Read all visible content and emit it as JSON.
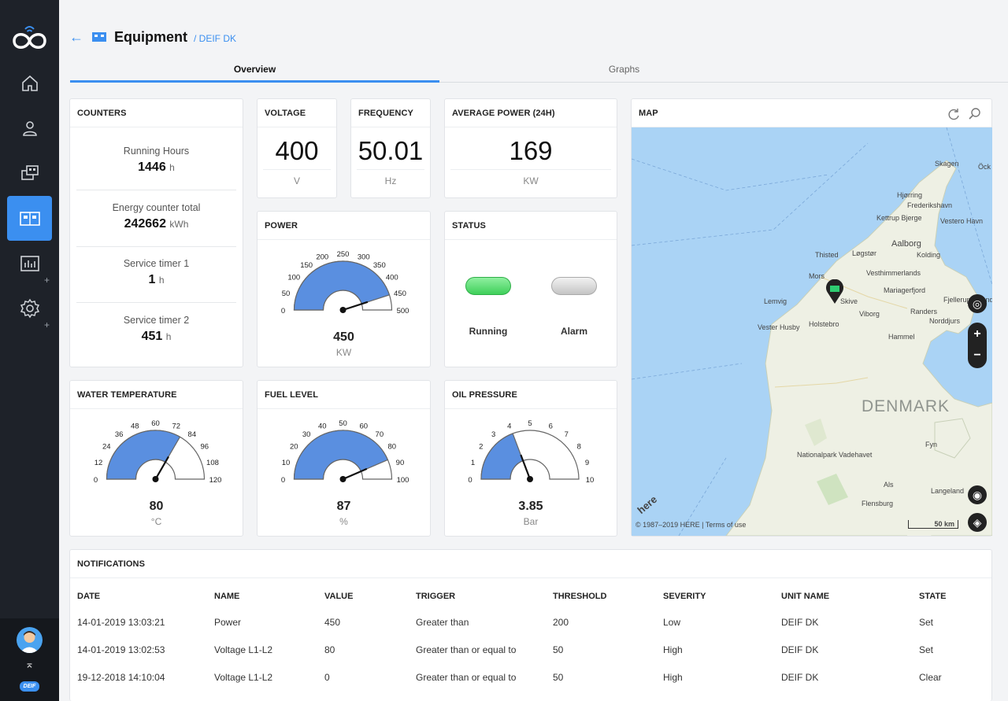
{
  "header": {
    "title": "Equipment",
    "breadcrumb": "/ DEIF DK"
  },
  "tabs": [
    {
      "label": "Overview",
      "active": true
    },
    {
      "label": "Graphs",
      "active": false
    }
  ],
  "counters": {
    "title": "COUNTERS",
    "items": [
      {
        "label": "Running Hours",
        "value": "1446",
        "unit": "h"
      },
      {
        "label": "Energy counter total",
        "value": "242662",
        "unit": "kWh"
      },
      {
        "label": "Service timer 1",
        "value": "1",
        "unit": "h"
      },
      {
        "label": "Service timer 2",
        "value": "451",
        "unit": "h"
      }
    ]
  },
  "voltage": {
    "title": "VOLTAGE",
    "value": "400",
    "unit": "V"
  },
  "frequency": {
    "title": "FREQUENCY",
    "value": "50.01",
    "unit": "Hz"
  },
  "avg_power": {
    "title": "AVERAGE POWER (24H)",
    "value": "169",
    "unit": "KW"
  },
  "power": {
    "title": "POWER",
    "value": "450",
    "unit": "KW",
    "min": 0,
    "max": 500,
    "fill_value": 450,
    "ticks": [
      "0",
      "50",
      "100",
      "150",
      "200",
      "250",
      "300",
      "350",
      "400",
      "450",
      "500"
    ]
  },
  "status": {
    "title": "STATUS",
    "running_label": "Running",
    "alarm_label": "Alarm",
    "running_color": "#4cd964",
    "alarm_color": "#cccccc"
  },
  "water_temp": {
    "title": "WATER TEMPERATURE",
    "value": "80",
    "unit": "°C",
    "min": 0,
    "max": 120,
    "fill_value": 80,
    "ticks": [
      "0",
      "12",
      "24",
      "36",
      "48",
      "60",
      "72",
      "84",
      "96",
      "108",
      "120"
    ]
  },
  "fuel_level": {
    "title": "FUEL LEVEL",
    "value": "87",
    "unit": "%",
    "min": 0,
    "max": 100,
    "fill_value": 87,
    "ticks": [
      "0",
      "10",
      "20",
      "30",
      "40",
      "50",
      "60",
      "70",
      "80",
      "90",
      "100"
    ]
  },
  "oil_pressure": {
    "title": "OIL PRESSURE",
    "value": "3.85",
    "unit": "Bar",
    "min": 0,
    "max": 10,
    "fill_value": 3.85,
    "ticks": [
      "0",
      "1",
      "2",
      "3",
      "4",
      "5",
      "6",
      "7",
      "8",
      "9",
      "10"
    ]
  },
  "map": {
    "title": "MAP",
    "country": "DENMARK",
    "attribution": "© 1987–2019 HERE | Terms of use",
    "scale": "50 km",
    "brand": "here",
    "places": [
      "Skagen",
      "Hjørring",
      "Frederikshavn",
      "Kettrup Bjerge",
      "Vestero Havn",
      "Aalborg",
      "Thisted",
      "Løgstør",
      "Kolding",
      "Mors",
      "Vesthimmerlands",
      "Mariagerfjord",
      "Lemvig",
      "Skive",
      "Viborg",
      "Randers",
      "Fjellerup Strand",
      "Norddjurs",
      "Vester Husby",
      "Holstebro",
      "Hammel",
      "Nationalpark Vadehavet",
      "Fyn",
      "Als",
      "Langeland",
      "Flensburg",
      "Öck"
    ],
    "zoom_in": "+",
    "zoom_out": "−"
  },
  "notifications": {
    "title": "NOTIFICATIONS",
    "columns": [
      "DATE",
      "NAME",
      "VALUE",
      "TRIGGER",
      "THRESHOLD",
      "SEVERITY",
      "UNIT NAME",
      "STATE"
    ],
    "rows": [
      [
        "14-01-2019 13:03:21",
        "Power",
        "450",
        "Greater than",
        "200",
        "Low",
        "DEIF DK",
        "Set"
      ],
      [
        "14-01-2019 13:02:53",
        "Voltage L1-L2",
        "80",
        "Greater than or equal to",
        "50",
        "High",
        "DEIF DK",
        "Set"
      ],
      [
        "19-12-2018 14:10:04",
        "Voltage L1-L2",
        "0",
        "Greater than or equal to",
        "50",
        "High",
        "DEIF DK",
        "Clear"
      ]
    ]
  },
  "colors": {
    "accent": "#3b8ff0",
    "gauge_fill": "#5a8fe0",
    "sidebar": "#1e2229"
  },
  "sidebar": {
    "items": [
      {
        "icon": "home-icon"
      },
      {
        "icon": "user-location-icon"
      },
      {
        "icon": "equipment-group-icon"
      },
      {
        "icon": "equipment-icon",
        "active": true
      },
      {
        "icon": "reports-icon"
      },
      {
        "icon": "settings-icon"
      }
    ],
    "brand": "DEIF"
  }
}
